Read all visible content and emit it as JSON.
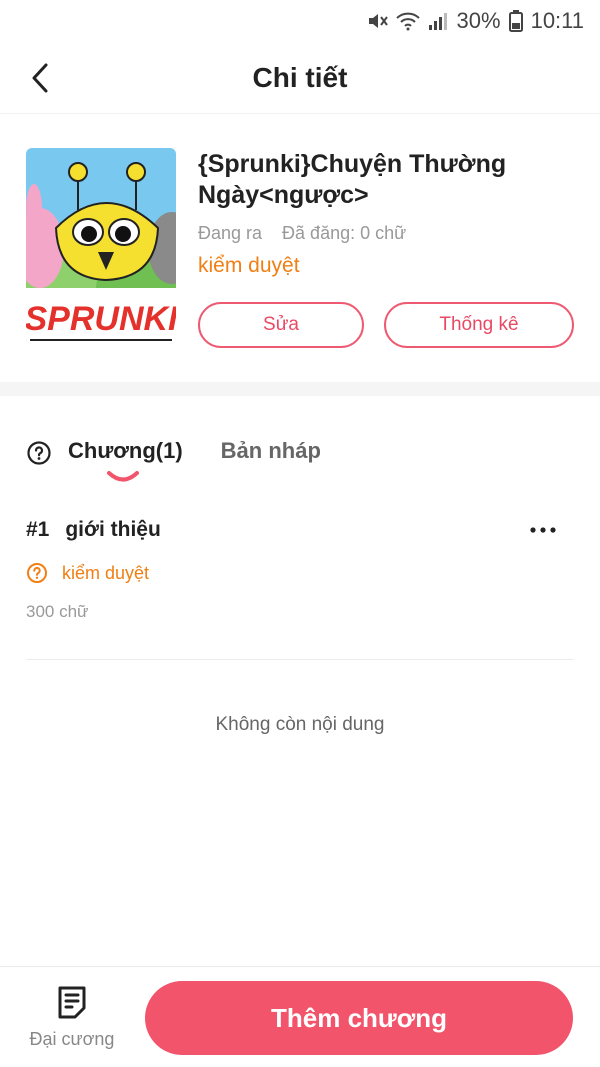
{
  "status_bar": {
    "battery": "30%",
    "time": "10:11"
  },
  "header": {
    "title": "Chi tiết",
    "back_icon": "chevron-left-icon"
  },
  "book": {
    "title": "{Sprunki}Chuyện Thường Ngày<ngược>",
    "status": "Đang ra",
    "published": "Đã đăng: 0 chữ",
    "review_state": "kiểm duyệt",
    "cover_text": "SPRUNKI",
    "edit_label": "Sửa",
    "stats_label": "Thống kê"
  },
  "tabs": {
    "chapters": "Chương(1)",
    "drafts": "Bản nháp"
  },
  "chapters": [
    {
      "number": "#1",
      "title": "giới thiệu",
      "state": "kiểm duyệt",
      "words": "300 chữ"
    }
  ],
  "empty_text": "Không còn nội dung",
  "bottom": {
    "outline_label": "Đại cương",
    "add_label": "Thêm chương"
  },
  "colors": {
    "accent": "#f2546c",
    "warning": "#f07f14"
  }
}
